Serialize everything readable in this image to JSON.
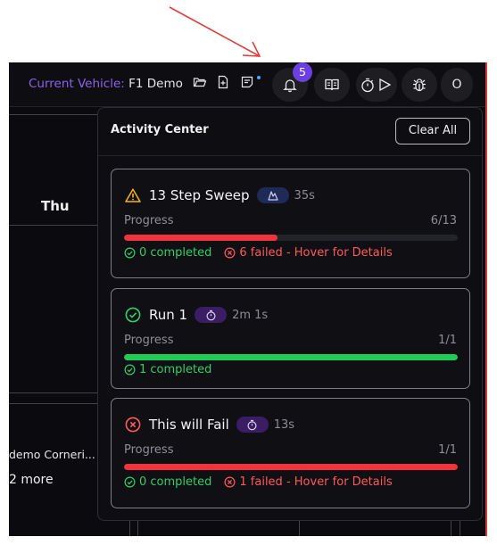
{
  "topbar": {
    "vehicle_label": "Current Vehicle:",
    "vehicle_value": "F1 Demo",
    "notification_count": "5",
    "user_initial": "O"
  },
  "calendar": {
    "day_label": "Thu",
    "event_label": "demo Corneri...",
    "more_label": "2 more"
  },
  "activity_center": {
    "title": "Activity Center",
    "clear_all_label": "Clear All",
    "progress_label": "Progress",
    "items": [
      {
        "title": "13 Step Sweep",
        "status": "warning",
        "type_icon": "sweep-icon",
        "duration": "35s",
        "count": "6/13",
        "progress": 0.46,
        "progress_color": "#f0333d",
        "completed": "0 completed",
        "failed": "6 failed - Hover for Details"
      },
      {
        "title": "Run 1",
        "status": "success",
        "type_icon": "stopwatch-icon",
        "duration": "2m 1s",
        "count": "1/1",
        "progress": 1.0,
        "progress_color": "#1fcb55",
        "completed": "1 completed",
        "failed": ""
      },
      {
        "title": "This will Fail",
        "status": "error",
        "type_icon": "stopwatch-icon",
        "duration": "13s",
        "count": "1/1",
        "progress": 1.0,
        "progress_color": "#f0333d",
        "completed": "0 completed",
        "failed": "1 failed - Hover for Details"
      }
    ]
  },
  "colors": {
    "accent": "#6b3fe0",
    "vehicle_label": "#8b63e8",
    "success": "#2fcf6a",
    "error": "#ff5a5a",
    "warning": "#f3b51b"
  }
}
